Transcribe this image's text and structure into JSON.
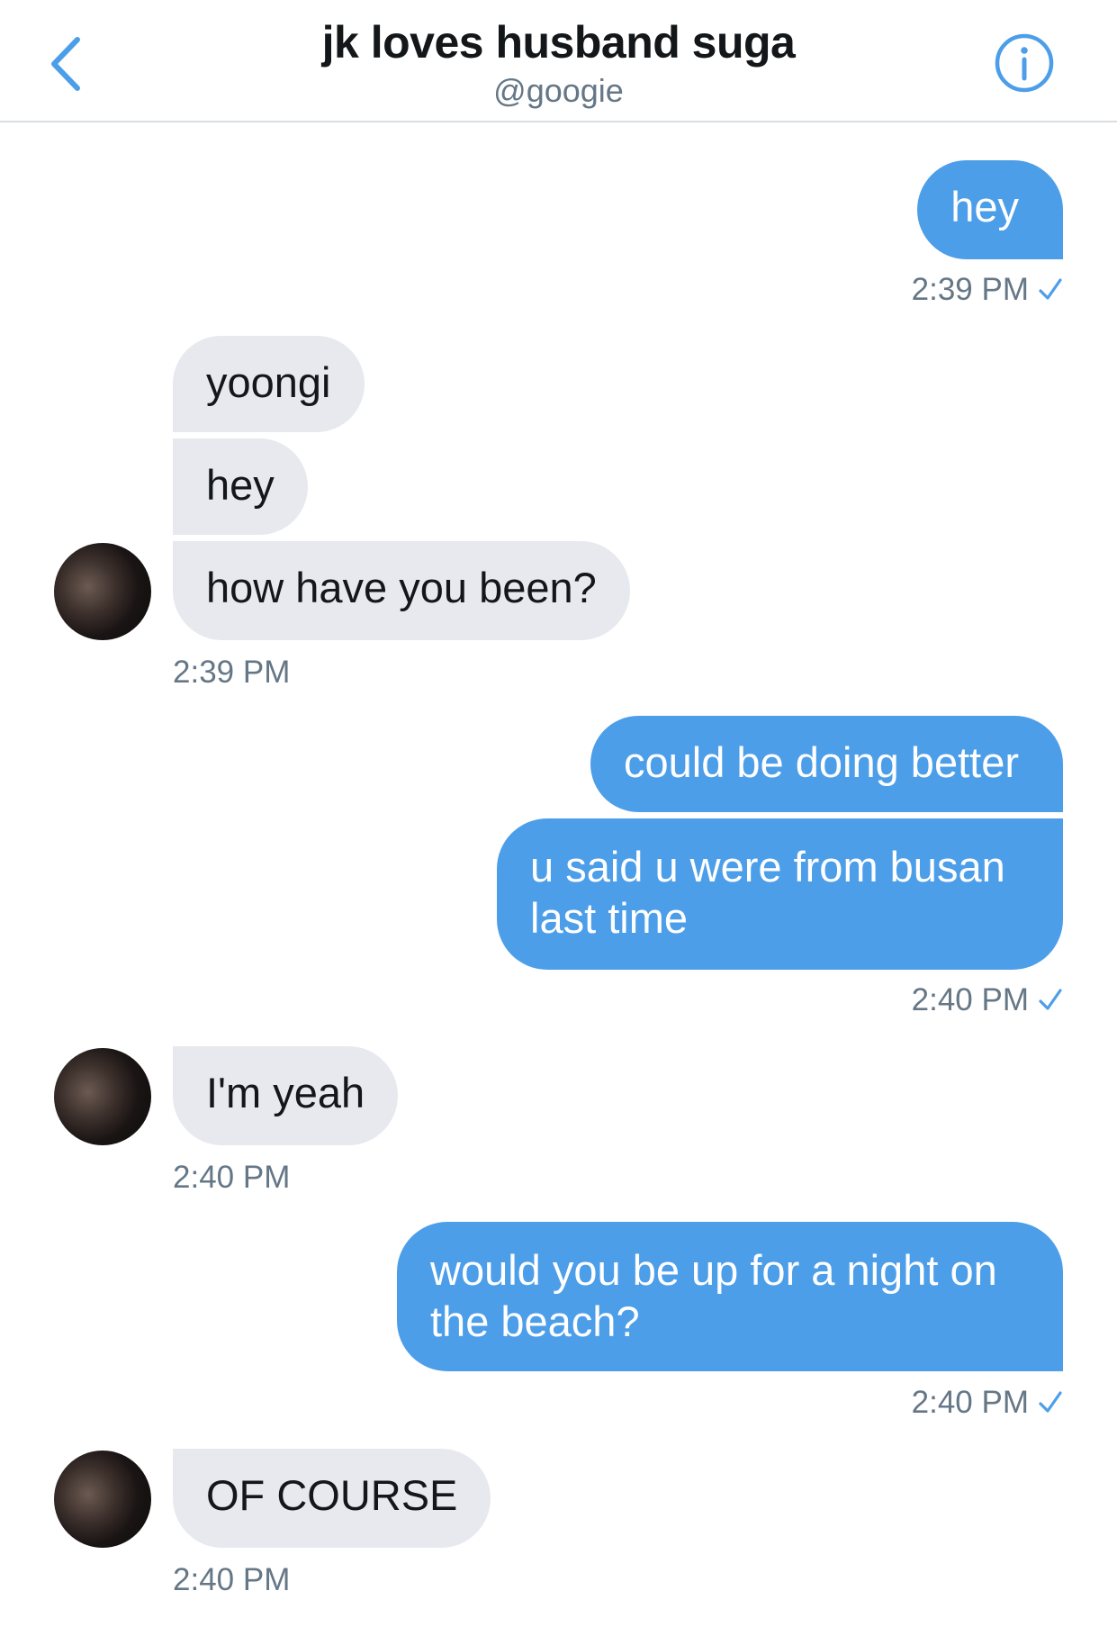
{
  "header": {
    "title": "jk loves husband suga",
    "handle": "@googie",
    "back_icon": "chevron-left-icon",
    "info_icon": "info-icon",
    "accent_color": "#4d9ee9"
  },
  "messages": [
    {
      "side": "out",
      "text": "hey"
    },
    {
      "side": "out_time",
      "text": "2:39 PM"
    },
    {
      "side": "in",
      "text": "yoongi"
    },
    {
      "side": "in",
      "text": "hey"
    },
    {
      "side": "in",
      "text": "how have you been?"
    },
    {
      "side": "in_time",
      "text": "2:39 PM"
    },
    {
      "side": "out",
      "text": "could be doing better"
    },
    {
      "side": "out",
      "text": "u said u were from busan last time"
    },
    {
      "side": "out_time",
      "text": "2:40 PM"
    },
    {
      "side": "in",
      "text": "I'm yeah"
    },
    {
      "side": "in_time",
      "text": "2:40 PM"
    },
    {
      "side": "out",
      "text": "would you be up for a night on the beach?"
    },
    {
      "side": "out_time",
      "text": "2:40 PM"
    },
    {
      "side": "in",
      "text": "OF COURSE"
    },
    {
      "side": "in_time",
      "text": "2:40 PM"
    }
  ],
  "colors": {
    "outgoing_bubble": "#4d9ee9",
    "incoming_bubble": "#e7e9ee",
    "timestamp": "#657786"
  }
}
